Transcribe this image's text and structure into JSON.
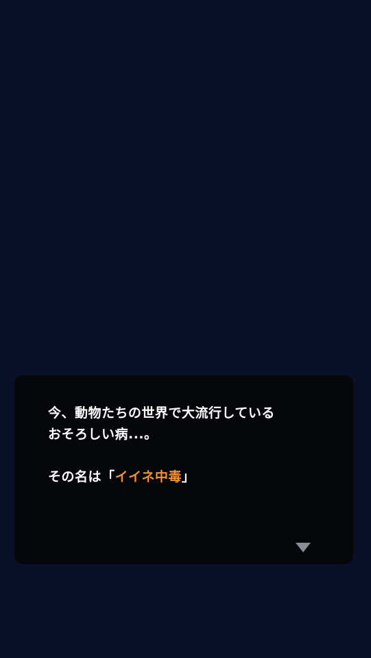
{
  "dialog": {
    "line1": "今、動物たちの世界で大流行している",
    "line2": "おそろしい病...。",
    "line3_prefix": "その名は「",
    "line3_highlight": "イイネ中毒",
    "line3_suffix": "」",
    "next_icon": "down-triangle"
  },
  "colors": {
    "background": "#0a1028",
    "dialog_background": "#06070b",
    "text": "#ffffff",
    "highlight": "#f0903a",
    "indicator": "#8a8d95"
  }
}
